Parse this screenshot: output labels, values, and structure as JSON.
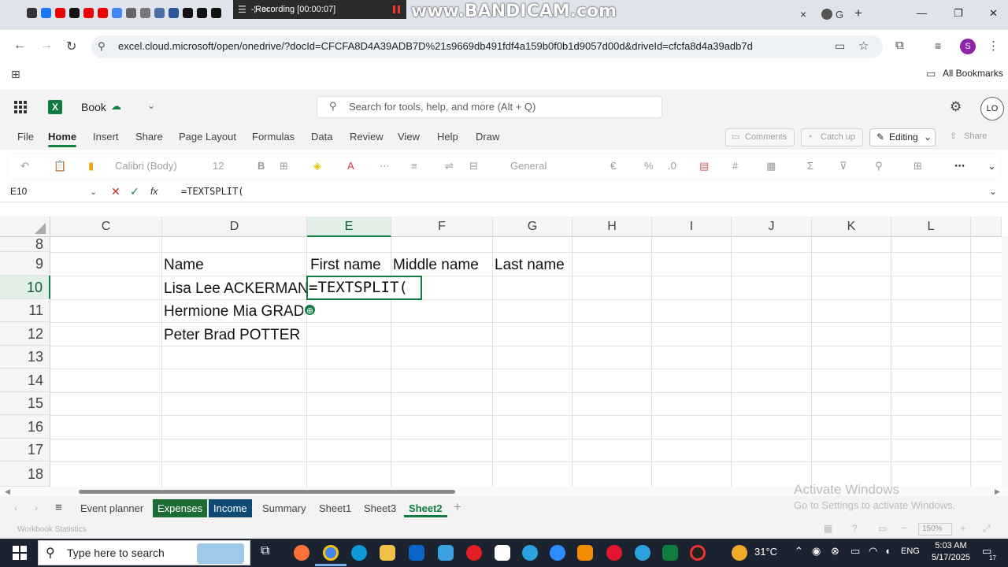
{
  "browser": {
    "recorder_label": "Recording [00:00:07]",
    "watermark": "www.BANDICAM.com",
    "url": "excel.cloud.microsoft/open/onedrive/?docId=CFCFA8D4A39ADB7D%21s9669db491fdf4a159b0f0b1d9057d00d&driveId=cfcfa8d4a39adb7d",
    "bookmarks_label": "All Bookmarks",
    "profile_initial": "S",
    "new_tab": "+",
    "tab_close": "×",
    "tab_letter": "G"
  },
  "app": {
    "book_name": "Book",
    "search_placeholder": "Search for tools, help, and more (Alt + Q)",
    "avatar_initials": "LO",
    "menus": [
      "File",
      "Home",
      "Insert",
      "Share",
      "Page Layout",
      "Formulas",
      "Data",
      "Review",
      "View",
      "Help",
      "Draw"
    ],
    "comments_label": "Comments",
    "catchup_label": "Catch up",
    "editing_label": "Editing",
    "share_label": "Share",
    "font_name": "Calibri (Body)",
    "font_size": "12",
    "number_format": "General"
  },
  "formula_bar": {
    "name_box": "E10",
    "fx_label": "fx",
    "formula": "=TEXTSPLIT("
  },
  "grid": {
    "columns": [
      "C",
      "D",
      "E",
      "F",
      "G",
      "H",
      "I",
      "J",
      "K",
      "L"
    ],
    "selected_column": "E",
    "rows": [
      "8",
      "9",
      "10",
      "11",
      "12",
      "13",
      "14",
      "15",
      "16",
      "17",
      "18"
    ],
    "selected_row": "10",
    "cells": {
      "D9": "Name",
      "E9": "First name",
      "F9": "Middle name",
      "G9": "Last name",
      "D10": "Lisa Lee ACKERMAN",
      "D11": "Hermione Mia GRAD",
      "D12": "Peter Brad POTTER",
      "E10": "=TEXTSPLIT("
    }
  },
  "sheets": {
    "tabs": [
      "Event planner",
      "Expenses",
      "Income",
      "Summary",
      "Sheet1",
      "Sheet3",
      "Sheet2"
    ],
    "active": "Sheet2",
    "add": "+"
  },
  "status": {
    "workbook_stats": "Workbook Statistics",
    "zoom": "150%",
    "activate_title": "Activate Windows",
    "activate_sub": "Go to Settings to activate Windows."
  },
  "taskbar": {
    "search_placeholder": "Type here to search",
    "temperature": "31°C",
    "language": "ENG",
    "time": "5:03 AM",
    "date": "5/17/2025",
    "notification_count": "17"
  },
  "colors": {
    "excel_green": "#107c41",
    "expenses_tab": "#1d6b35",
    "income_tab": "#0f4a75",
    "taskbar": "#1c2330"
  }
}
